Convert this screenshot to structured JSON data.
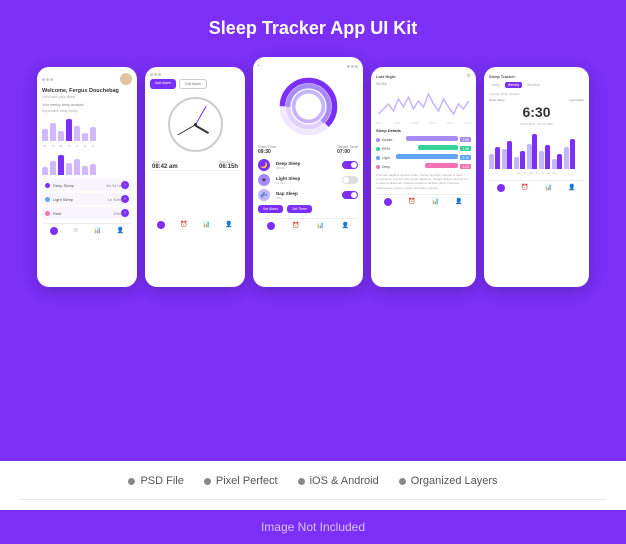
{
  "header": {
    "title": "Sleep Tracker App UI Kit"
  },
  "phone1": {
    "greeting": "Welcome, Fergus Douchebag",
    "desc": "Let's track your sleep",
    "week_label": "Your weekly sleep analysis",
    "week_sub": "Impressive sleep today",
    "days": [
      "Mon",
      "Tue",
      "Wed",
      "Thu",
      "Fri",
      "Sat",
      "Sun"
    ],
    "deep_sleep_label": "Deep Sleep",
    "deep_sleep_val": "4h 34 hr",
    "light_sleep_label": "Light Sleep",
    "light_sleep_val": "1h 50m",
    "rest_label": "Rest",
    "rest_val": "45m"
  },
  "phone2": {
    "add_alarm": "Add Alarm",
    "edit_alarm": "Edit Alarm",
    "time_label": "Time",
    "time_val": "08:42 am",
    "duration_label": "Duration",
    "duration_val": "06:15h"
  },
  "phone3": {
    "start_time_label": "Start Time",
    "start_time_val": "09:30",
    "target_time_label": "Target Time",
    "target_time_val": "07:00",
    "deep_sleep": "Deep Sleep",
    "deep_sleep_sub": "06:30+",
    "light_sleep": "Light Sleep",
    "light_sleep_sub": "01:30+",
    "nap_sleep": "Nap Sleep",
    "nap_sleep_sub": "45m",
    "set_alarm": "Set Alarm",
    "set_timer": "Set Timer"
  },
  "phone4": {
    "title": "Last Night",
    "time": "08:05a",
    "sleep_label": "Sleep",
    "details_title": "Sleep Details",
    "awake": "Awake",
    "rem": "REM",
    "light": "Light",
    "deep": "Deep",
    "awake_val": "1:45",
    "rem_val": "1:28",
    "light_val": "3:10",
    "deep_val": "1:22",
    "lorem": "Praesent dapibus facilisis varius. Donec tincidunt magnat of diam consectetur, a auctor dico sleep aliquenet. Integer lacinia volutpat orci in deep id aliquenet. Praesent dapibus facilisis varius pharetra pellentesque. Donec a justo sed tellus imperite."
  },
  "phone5": {
    "title": "Sleep Tracker",
    "tabs": [
      "Daily",
      "Weekly",
      "Monthly"
    ],
    "active_tab": "Weekly",
    "subtitle": "Average sleep duration",
    "left_label": "Deep Sleep",
    "right_label": "Light Sleep",
    "big_time": "6:30",
    "date_range": "12.07.2021 - 18.07.2021",
    "day_labels": [
      "Mo",
      "Tu",
      "We",
      "Th",
      "Fr",
      "Sa",
      "Su"
    ]
  },
  "features": [
    {
      "label": "PSD File"
    },
    {
      "label": "Pixel Perfect"
    },
    {
      "label": "iOS & Android"
    },
    {
      "label": "Organized Layers"
    }
  ],
  "footer": {
    "text": "Image Not Included"
  }
}
